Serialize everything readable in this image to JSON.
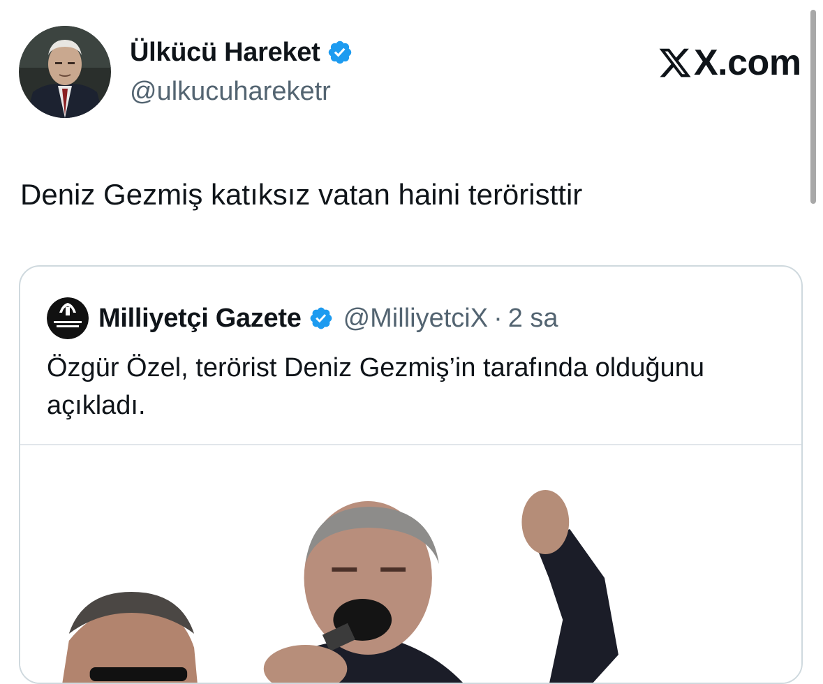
{
  "author": {
    "name": "Ülkücü Hareket",
    "handle": "@ulkucuhareketr",
    "verified_badge_icon": "verified-check-icon",
    "badge_color": "#1d9bf0"
  },
  "brand": {
    "domain": "X.com",
    "logo_icon": "x-logo-icon"
  },
  "tweet": {
    "text": "Deniz Gezmiş katıksız vatan haini teröristtir"
  },
  "quoted_tweet": {
    "name": "Milliyetçi Gazete",
    "handle": "@MilliyetciX",
    "separator": "·",
    "time": "2 sa",
    "text": "Özgür Özel, terörist Deniz Gezmiş’in tarafında olduğunu açıkladı.",
    "avatar_label": "MİLLİYETÇİ GAZETE",
    "media_icon": "speech-photo-image"
  },
  "colors": {
    "text_primary": "#0f1419",
    "text_secondary": "#536471",
    "border": "#cfd9de",
    "verified": "#1d9bf0"
  }
}
